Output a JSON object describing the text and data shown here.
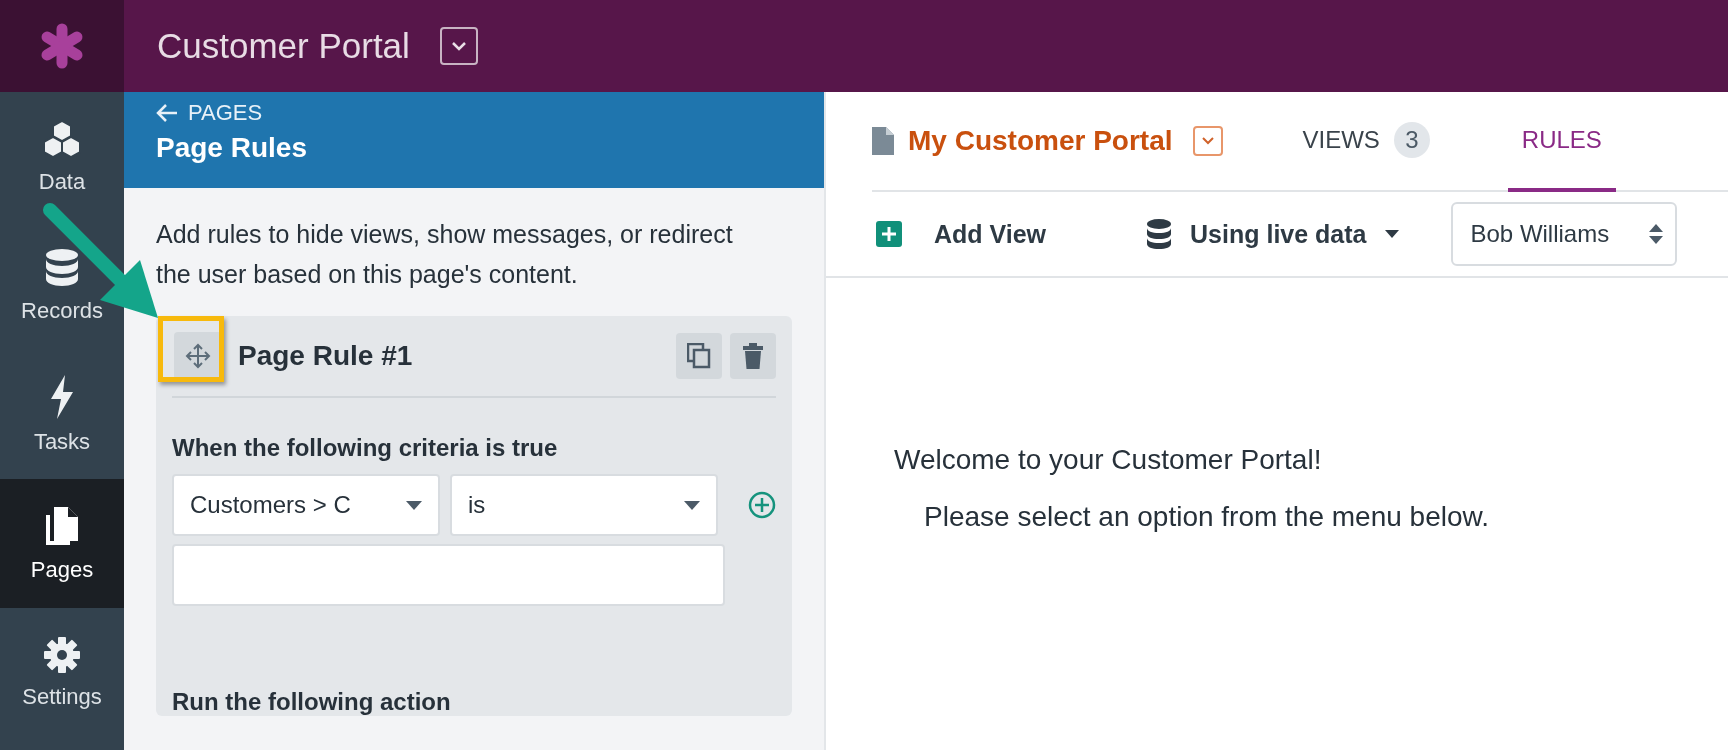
{
  "app": {
    "title": "Customer Portal"
  },
  "sidebar": {
    "items": [
      {
        "label": "Data",
        "selected": false
      },
      {
        "label": "Records",
        "selected": false
      },
      {
        "label": "Tasks",
        "selected": false
      },
      {
        "label": "Pages",
        "selected": true
      },
      {
        "label": "Settings",
        "selected": false
      }
    ]
  },
  "panel": {
    "back_link": "PAGES",
    "title": "Page Rules",
    "description": "Add rules to hide views, show messages, or redirect the user based on this page's content.",
    "rule": {
      "title": "Page Rule #1",
      "criteria_heading": "When the following criteria is true",
      "field_select": "Customers > C",
      "operator_select": "is",
      "action_heading": "Run the following action"
    }
  },
  "page": {
    "name": "My Customer Portal",
    "tabs": [
      {
        "label": "VIEWS",
        "count": "3",
        "selected": false
      },
      {
        "label": "RULES",
        "selected": true
      }
    ],
    "toolbar": {
      "add_view": "Add View",
      "data_source": "Using live data",
      "user_select": "Bob Williams"
    },
    "welcome": [
      "Welcome to your Customer Portal!",
      "Please select an option from the menu below."
    ]
  }
}
